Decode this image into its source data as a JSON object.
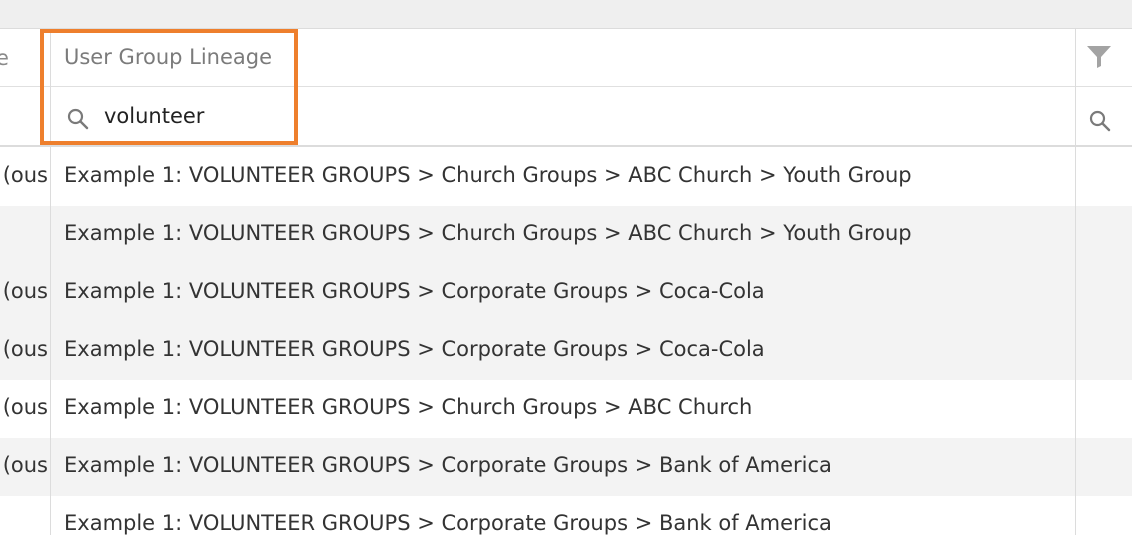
{
  "columns": {
    "previous_header_fragment": "e",
    "lineage_header": "User Group Lineage"
  },
  "filter": {
    "value": "volunteer"
  },
  "icons": {
    "column_filter": "funnel-icon",
    "search": "search-icon"
  },
  "accent_color": "#ee7f2d",
  "rows": [
    {
      "prev": "ous)",
      "lineage": "Example 1: VOLUNTEER GROUPS > Church Groups > ABC Church > Youth Group"
    },
    {
      "prev": "",
      "lineage": "Example 1: VOLUNTEER GROUPS > Church Groups > ABC Church > Youth Group"
    },
    {
      "prev": "ous)",
      "lineage": "Example 1: VOLUNTEER GROUPS > Corporate Groups > Coca-Cola"
    },
    {
      "prev": "ous)",
      "lineage": "Example 1: VOLUNTEER GROUPS > Corporate Groups > Coca-Cola"
    },
    {
      "prev": "ous)",
      "lineage": "Example 1: VOLUNTEER GROUPS > Church Groups > ABC Church"
    },
    {
      "prev": "ous)",
      "lineage": "Example 1: VOLUNTEER GROUPS > Corporate Groups > Bank of America"
    },
    {
      "prev": "",
      "lineage": "Example 1: VOLUNTEER GROUPS > Corporate Groups > Bank of America"
    }
  ]
}
